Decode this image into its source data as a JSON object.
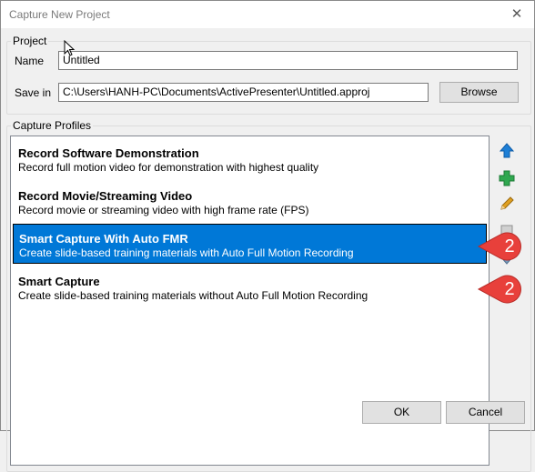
{
  "window": {
    "title": "Capture New Project",
    "close_glyph": "✕"
  },
  "project": {
    "group_label": "Project",
    "name_label": "Name",
    "name_value": "Untitled",
    "savein_label": "Save in",
    "savein_value": "C:\\Users\\HANH-PC\\Documents\\ActivePresenter\\Untitled.approj",
    "browse_label": "Browse"
  },
  "profiles": {
    "group_label": "Capture Profiles",
    "items": [
      {
        "name": "Record Software Demonstration",
        "desc": "Record full motion video for demonstration with highest quality"
      },
      {
        "name": "Record Movie/Streaming Video",
        "desc": "Record movie or streaming video with high frame rate (FPS)"
      },
      {
        "name": "Smart Capture With Auto FMR",
        "desc": "Create slide-based training materials with Auto Full Motion Recording"
      },
      {
        "name": "Smart Capture",
        "desc": "Create slide-based training materials without Auto Full Motion Recording"
      }
    ],
    "selected_index": 2,
    "tools": [
      "move-up-icon",
      "add-icon",
      "edit-icon",
      "delete-icon",
      "move-down-icon"
    ]
  },
  "callouts": [
    {
      "number": "2",
      "target": "Smart Capture With Auto FMR"
    },
    {
      "number": "2",
      "target": "Smart Capture"
    }
  ],
  "footer": {
    "ok_label": "OK",
    "cancel_label": "Cancel"
  },
  "colors": {
    "selection": "#0078d7",
    "callout": "#e8403b",
    "move_up": "#1e7fd6",
    "add": "#2fa84f",
    "edit": "#e0a020"
  }
}
